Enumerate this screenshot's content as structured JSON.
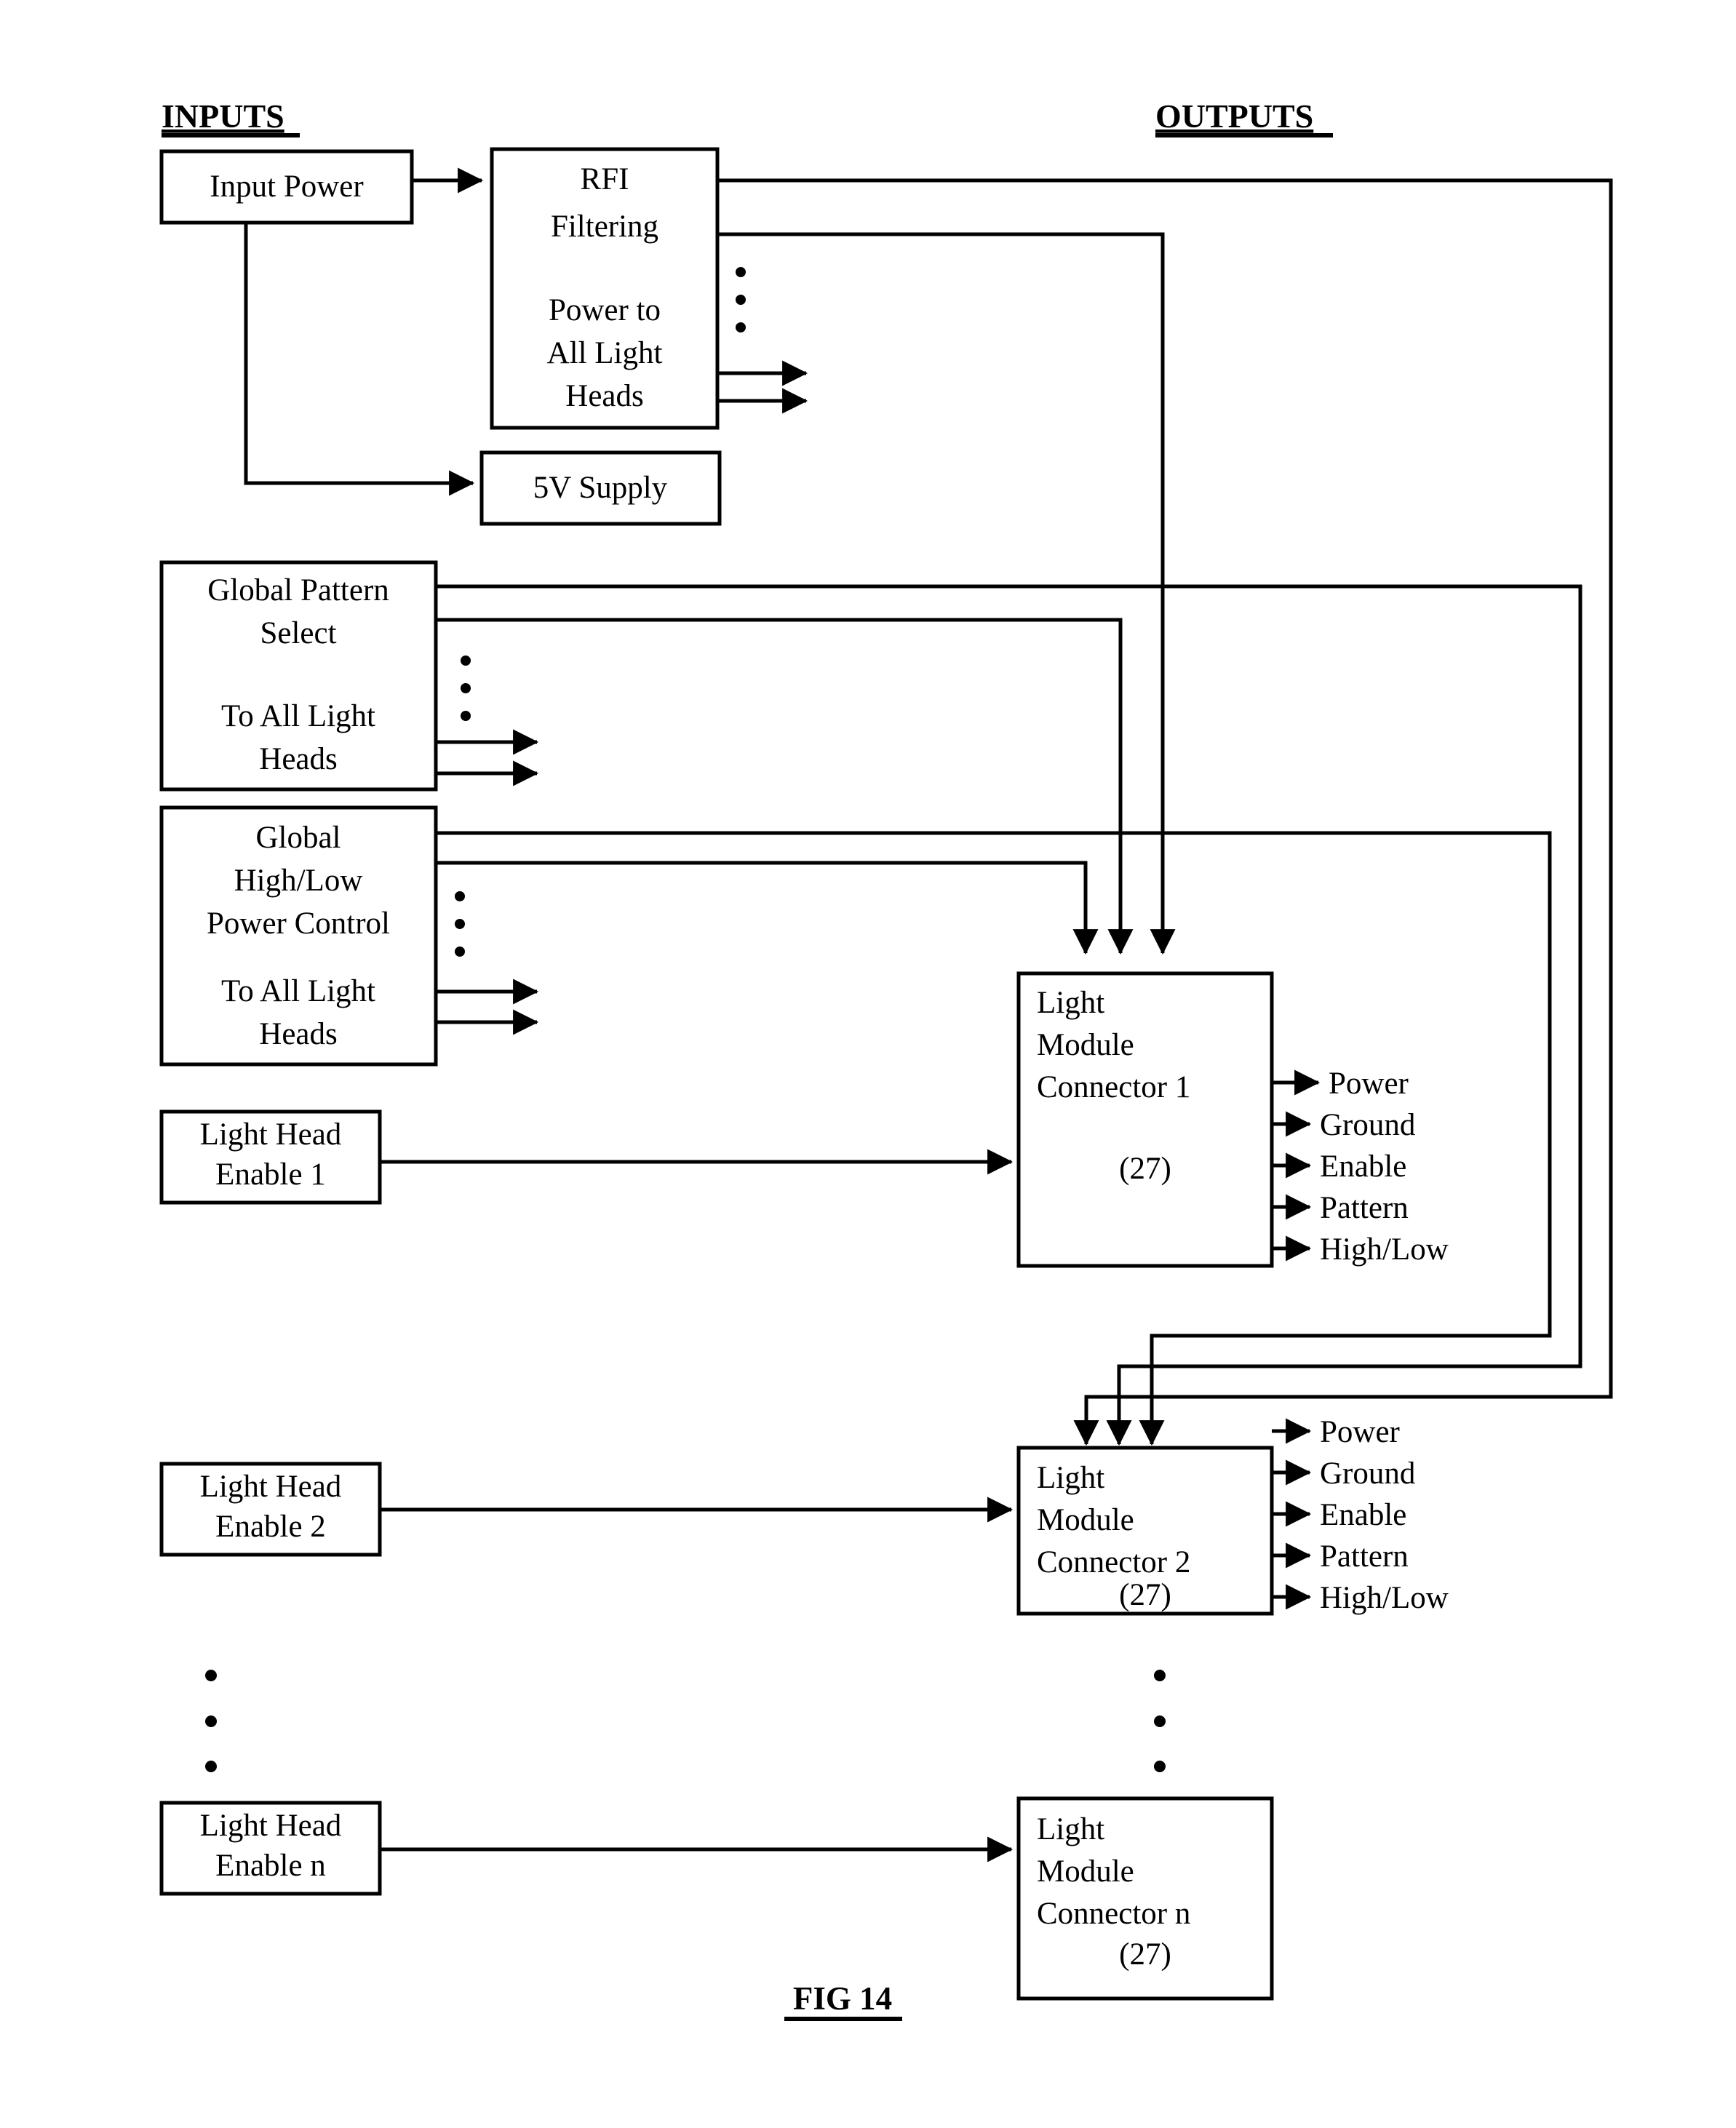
{
  "figure": {
    "label": "FIG 14",
    "inputs_header": "INPUTS",
    "outputs_header": "OUTPUTS"
  },
  "inputs": {
    "input_power": {
      "label": "Input Power"
    },
    "rfi": {
      "line1": "RFI",
      "line2": "Filtering",
      "line3": "Power to",
      "line4": "All Light",
      "line5": "Heads"
    },
    "supply": {
      "label": "5V Supply"
    },
    "global_pattern": {
      "line1": "Global Pattern",
      "line2": "Select",
      "line3": "To All Light",
      "line4": "Heads"
    },
    "global_highlow": {
      "line1": "Global",
      "line2": "High/Low",
      "line3": "Power Control",
      "line4": "To All Light",
      "line5": "Heads"
    },
    "enables": [
      {
        "line1": "Light Head",
        "line2": "Enable 1"
      },
      {
        "line1": "Light Head",
        "line2": "Enable 2"
      },
      {
        "line1": "Light Head",
        "line2": "Enable n"
      }
    ]
  },
  "connectors": [
    {
      "line1": "Light",
      "line2": "Module",
      "line3": "Connector 1",
      "ref": "(27)",
      "outputs": [
        "Power",
        "Ground",
        "Enable",
        "Pattern",
        "High/Low"
      ]
    },
    {
      "line1": "Light",
      "line2": "Module",
      "line3": "Connector 2",
      "ref": "(27)",
      "outputs": [
        "Power",
        "Ground",
        "Enable",
        "Pattern",
        "High/Low"
      ]
    },
    {
      "line1": "Light",
      "line2": "Module",
      "line3": "Connector n",
      "ref": "(27)",
      "outputs": []
    }
  ],
  "colors": {
    "ink": "#000000",
    "paper": "#ffffff"
  }
}
